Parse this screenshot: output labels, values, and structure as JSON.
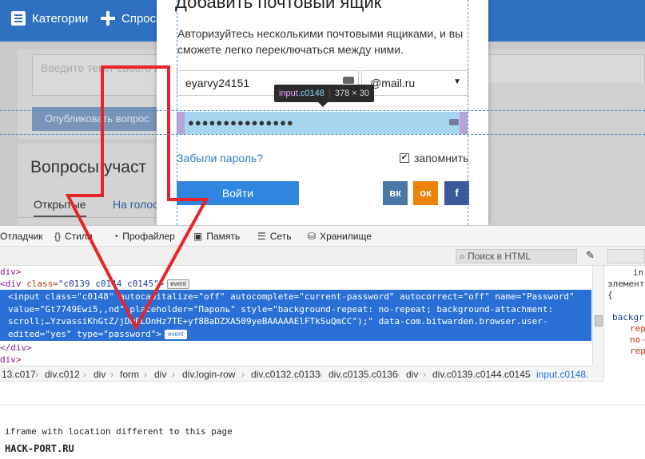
{
  "site": {
    "nav": {
      "categories": "Категории",
      "ask": "Спрос"
    },
    "bg": {
      "textarea_placeholder": "Введите текст своего в",
      "publish": "Опубликовать вопрос",
      "heading": "Вопросы участ",
      "tab_open": "Открытые",
      "tab_vote": "На голос"
    }
  },
  "modal": {
    "title": "Добавить почтовый ящик",
    "description": "Авторизуйтесь несколькими почтовыми ящиками, и вы сможете легко переключаться между ними.",
    "login_value": "eyarvy24151",
    "domain_value": "@mail.ru",
    "password_mask": "●●●●●●●●●●●●●●●",
    "tooltip_selector": "input",
    "tooltip_class": ".c0148",
    "tooltip_size": "378 × 30",
    "forgot": "Забыли пароль?",
    "remember": "запомнить",
    "login_button": "Войти",
    "vk": "вк",
    "ok": "ок",
    "fb": "f"
  },
  "devtools": {
    "tabs": {
      "debugger": "Отладчик",
      "styles": "Стили",
      "profiler": "Профайлер",
      "memory": "Память",
      "network": "Сеть",
      "storage": "Хранилище"
    },
    "search_html": "Поиск в HTML",
    "code": {
      "line1": "div>",
      "line2_tag": "<div",
      "line2_attr": "class=",
      "line2_val": "\"c0139 c0144 c0145\"",
      "line2_end": ">",
      "badge_event": "event",
      "sel1": "<input class=\"c0148\" autocapitalize=\"off\" autocomplete=\"current-password\" autocorrect=\"off\" name=\"Password\"",
      "sel2": "value=\"Gt7749Ewi5,,nd\" placeholder=\"Пароль\" style=\"background-repeat: no-repeat; background-attachment:",
      "sel3": "scroll;…YzvassiKhGtZ/jDwELOnHz7TE+yf8BaDZXA509yeBAAAAAElFTkSuQmCC\");\" data-com.bitwarden.browser.user-",
      "sel4": "edited=\"yes\" type=\"password\">",
      "line_close1": "</div>",
      "line_close2": "div>"
    },
    "breadcrumbs": [
      "13.c017",
      "div.c012",
      "div",
      "form",
      "div",
      "div.login-row",
      "div.c0132.c0133",
      "div.c0135.c0136",
      "div",
      "div.c0139.c0144.c0145",
      "input.c0148."
    ],
    "rules": {
      "r1": "in",
      "r2": "элемент",
      "r3": "{",
      "r4": "backgr",
      "r5": "rep",
      "r6": "no-",
      "r7": "rep"
    },
    "console_message": "iframe with location different to this page",
    "watermark": "HACK-PORT.RU"
  }
}
